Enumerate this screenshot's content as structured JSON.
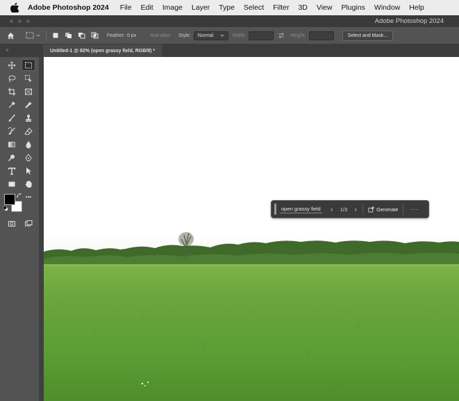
{
  "menubar": {
    "app_name": "Adobe Photoshop 2024",
    "items": [
      "File",
      "Edit",
      "Image",
      "Layer",
      "Type",
      "Select",
      "Filter",
      "3D",
      "View",
      "Plugins",
      "Window",
      "Help"
    ]
  },
  "window": {
    "title": "Adobe Photoshop 2024"
  },
  "options": {
    "feather_label": "Feather:",
    "feather_value": "0 px",
    "anti_alias": "Anti-alias",
    "style_label": "Style:",
    "style_value": "Normal",
    "width_label": "Width:",
    "height_label": "Height:",
    "select_mask": "Select and Mask..."
  },
  "document": {
    "tab_title": "Untitled-1 @ 82% (open grassy field, RGB/8) *"
  },
  "taskbar": {
    "prompt": "open grassy field",
    "counter": "1/3",
    "generate_label": "Generate",
    "more": "···"
  },
  "toolbar": {
    "more_tools": "•••"
  },
  "colors": {
    "foreground": "#000000",
    "background": "#ffffff",
    "grass": "#5fa23a",
    "sky": "#ffffff"
  }
}
